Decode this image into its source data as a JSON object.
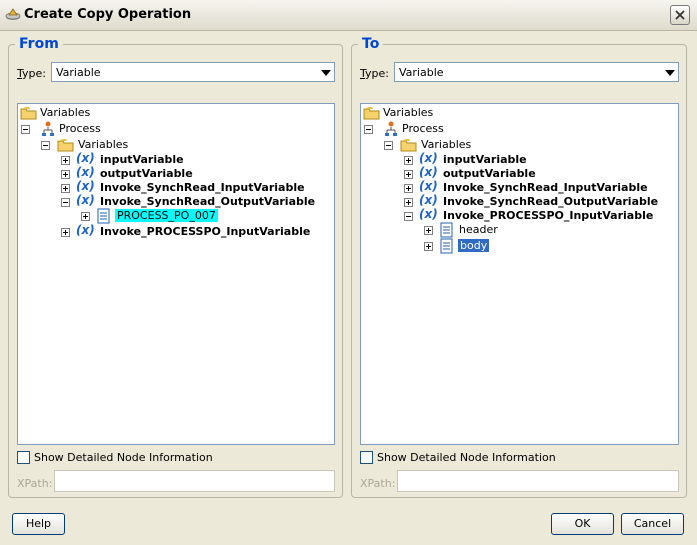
{
  "window": {
    "title": "Create Copy Operation"
  },
  "from": {
    "title": "From",
    "type_label": "Type:",
    "type_value": "Variable",
    "show_detail_label": "Show Detailed Node Information",
    "xpath_label": "XPath:",
    "tree": {
      "root": "Variables",
      "process": "Process",
      "variables": "Variables",
      "items": [
        "inputVariable",
        "outputVariable",
        "Invoke_SynchRead_InputVariable",
        "Invoke_SynchRead_OutputVariable",
        "Invoke_PROCESSPO_InputVariable"
      ],
      "child": "PROCESS_PO_007"
    }
  },
  "to": {
    "title": "To",
    "type_label": "Type:",
    "type_value": "Variable",
    "show_detail_label": "Show Detailed Node Information",
    "xpath_label": "XPath:",
    "tree": {
      "root": "Variables",
      "process": "Process",
      "variables": "Variables",
      "items": [
        "inputVariable",
        "outputVariable",
        "Invoke_SynchRead_InputVariable",
        "Invoke_SynchRead_OutputVariable",
        "Invoke_PROCESSPO_InputVariable"
      ],
      "children": [
        "header",
        "body"
      ]
    }
  },
  "buttons": {
    "help": "Help",
    "ok": "OK",
    "cancel": "Cancel"
  },
  "colors": {
    "group_title": "#0046d5",
    "selection_cyan": "#00ffff",
    "selection_blue": "#316ac5"
  }
}
